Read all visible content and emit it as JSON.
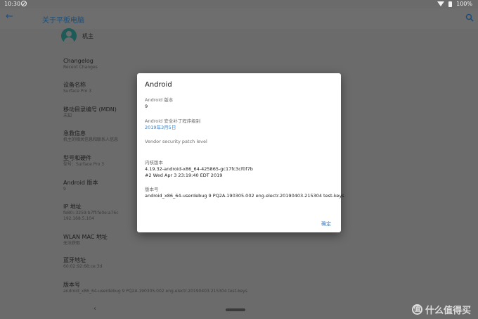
{
  "status_bar": {
    "time": "10:30",
    "battery": "100%"
  },
  "app_bar": {
    "title": "关于平板电脑",
    "icons": [
      "back-arrow-icon",
      "search-icon"
    ]
  },
  "owner": {
    "label": "机主"
  },
  "settings": [
    {
      "title": "Changelog",
      "subtitle": "Recent Changes"
    },
    {
      "title": "设备名称",
      "subtitle": "Surface Pro 3"
    },
    {
      "title": "移动目录编号 (MDN)",
      "subtitle": "未知"
    },
    {
      "title": "急救信息",
      "subtitle": "机主的相关信息和联系人信息"
    },
    {
      "title": "型号和硬件",
      "subtitle": "型号：Surface Pro 3"
    },
    {
      "title": "Android 版本",
      "subtitle": "9"
    },
    {
      "title": "IP 地址",
      "subtitle": "fe80::3259:b7ff:fe0e:a76c",
      "subtitle2": "192.168.5.104"
    },
    {
      "title": "WLAN MAC 地址",
      "subtitle": "无法获取"
    },
    {
      "title": "蓝牙地址",
      "subtitle": "60:02:92:68:ce:3d"
    },
    {
      "title": "版本号",
      "subtitle": "android_x86_64-userdebug 9 PQ2A.190305.002 eng.electr.20190403.215304 test-keys"
    }
  ],
  "dialog": {
    "title": "Android",
    "items": [
      {
        "label": "Android 版本",
        "value": "9"
      },
      {
        "label": "Android 安全补丁程序级别",
        "value": "2019年3月5日",
        "link": true
      },
      {
        "label": "Vendor security patch level",
        "value": ""
      },
      {
        "label": "内核版本",
        "value": "4.19.32-android-x86_64-425865-gc17fc3cf0f7b",
        "value2": "#2 Wed Apr 3 23:19:40 EDT 2019"
      },
      {
        "label": "版本号",
        "value": "android_x86_64-userdebug 9 PQ2A.190305.002 eng.electr.20190403.215304 test-keys"
      }
    ],
    "ok_label": "确定"
  },
  "nav_bar": {
    "back": "‹"
  },
  "watermark": {
    "symbol": "值",
    "text": "什么值得买"
  },
  "colors": {
    "accent": "#3b7ec2",
    "dim_background": "#6b6b6b",
    "app_bar_title": "#1d4d77",
    "avatar": "#1e5a58"
  }
}
